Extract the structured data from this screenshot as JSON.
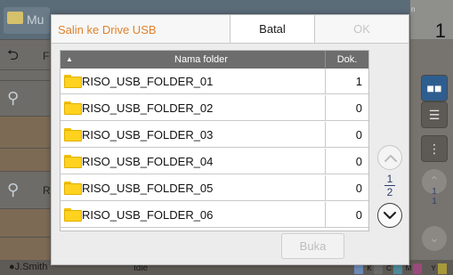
{
  "background": {
    "app_title_partial": "Mu",
    "count_value": "1",
    "count_label_partial": "n",
    "row_chars": [
      "F",
      "R"
    ],
    "user": "J.Smith",
    "status": "Idle",
    "ink_labels": [
      "K",
      "C",
      "M",
      "Y"
    ],
    "page": {
      "current": "1",
      "total": "1"
    }
  },
  "dialog": {
    "title": "Salin ke Drive USB",
    "cancel_label": "Batal",
    "ok_label": "OK",
    "open_label": "Buka",
    "table": {
      "columns": {
        "name": "Nama folder",
        "count": "Dok."
      },
      "sort_indicator": "▲",
      "rows": [
        {
          "name": "RISO_USB_FOLDER_01",
          "count": "1"
        },
        {
          "name": "RISO_USB_FOLDER_02",
          "count": "0"
        },
        {
          "name": "RISO_USB_FOLDER_03",
          "count": "0"
        },
        {
          "name": "RISO_USB_FOLDER_04",
          "count": "0"
        },
        {
          "name": "RISO_USB_FOLDER_05",
          "count": "0"
        },
        {
          "name": "RISO_USB_FOLDER_06",
          "count": "0"
        }
      ]
    },
    "pager": {
      "current": "1",
      "total": "2"
    }
  },
  "colors": {
    "title_accent": "#e0822a",
    "folder_yellow": "#ffd21f",
    "header_gray": "#6d6d6d",
    "disabled_text": "#c4c4c4"
  }
}
